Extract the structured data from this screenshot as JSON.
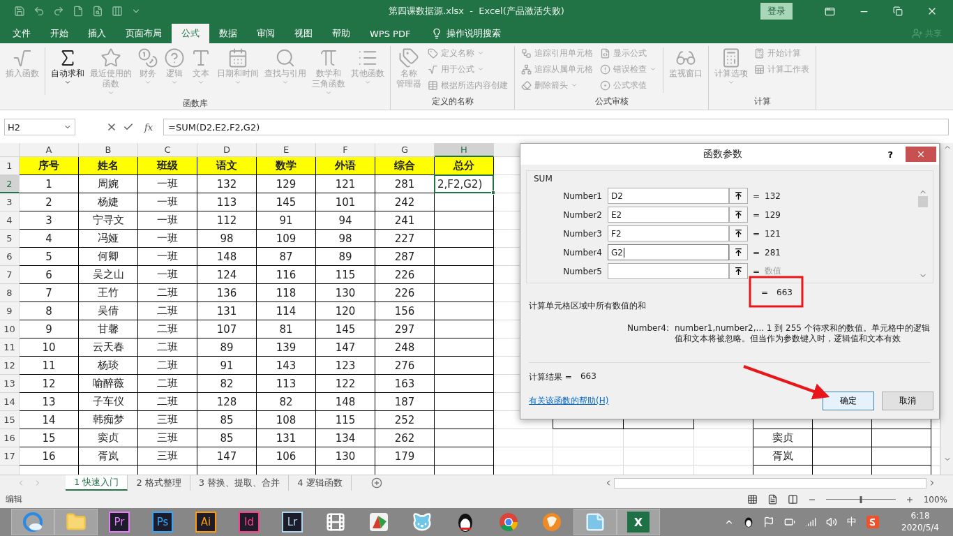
{
  "title_bar": {
    "title": "第四课数据源.xlsx  -  Excel(产品激活失败)",
    "sign_in": "登录"
  },
  "ribbon_tabs": [
    {
      "label": "文件",
      "selected": false
    },
    {
      "label": "开始",
      "selected": false
    },
    {
      "label": "插入",
      "selected": false
    },
    {
      "label": "页面布局",
      "selected": false
    },
    {
      "label": "公式",
      "selected": true
    },
    {
      "label": "数据",
      "selected": false
    },
    {
      "label": "审阅",
      "selected": false
    },
    {
      "label": "视图",
      "selected": false
    },
    {
      "label": "帮助",
      "selected": false
    },
    {
      "label": "WPS PDF",
      "selected": false
    }
  ],
  "tell_me": "操作说明搜索",
  "share": "共享",
  "ribbon_groups": [
    {
      "label": "函数库",
      "items": [
        {
          "label": "插入函数",
          "kind": "large",
          "disabled": true,
          "dropdown": false
        },
        {
          "label": "自动求和",
          "kind": "large",
          "disabled": false,
          "dropdown": true
        },
        {
          "label": "最近使用的",
          "label2": "函数",
          "kind": "large",
          "disabled": true,
          "dropdown": true
        },
        {
          "label": "财务",
          "kind": "large",
          "disabled": true,
          "dropdown": true
        },
        {
          "label": "逻辑",
          "kind": "large",
          "disabled": true,
          "dropdown": true
        },
        {
          "label": "文本",
          "kind": "large",
          "disabled": true,
          "dropdown": true
        },
        {
          "label": "日期和时间",
          "kind": "large",
          "disabled": true,
          "dropdown": true
        },
        {
          "label": "查找与引用",
          "kind": "large",
          "disabled": true,
          "dropdown": true
        },
        {
          "label": "数学和",
          "label2": "三角函数",
          "kind": "large",
          "disabled": true,
          "dropdown": true
        },
        {
          "label": "其他函数",
          "kind": "large",
          "disabled": true,
          "dropdown": true
        }
      ]
    },
    {
      "label": "定义的名称",
      "items": [
        {
          "label": "名称",
          "label2": "管理器",
          "kind": "large",
          "disabled": true,
          "dropdown": false
        },
        {
          "label": "定义名称",
          "kind": "small",
          "disabled": true,
          "dropdown": true
        },
        {
          "label": "用于公式",
          "kind": "small",
          "disabled": true,
          "dropdown": true
        },
        {
          "label": "根据所选内容创建",
          "kind": "small",
          "disabled": true,
          "dropdown": false
        }
      ]
    },
    {
      "label": "公式审核",
      "items": [
        {
          "label": "追踪引用单元格",
          "kind": "small",
          "disabled": true,
          "dropdown": false
        },
        {
          "label": "追踪从属单元格",
          "kind": "small",
          "disabled": true,
          "dropdown": false
        },
        {
          "label": "删除箭头",
          "kind": "small",
          "disabled": true,
          "dropdown": true
        },
        {
          "label": "显示公式",
          "kind": "small",
          "disabled": true,
          "dropdown": false
        },
        {
          "label": "错误检查",
          "kind": "small",
          "disabled": true,
          "dropdown": true
        },
        {
          "label": "公式求值",
          "kind": "small",
          "disabled": true,
          "dropdown": false
        },
        {
          "label": "监视窗口",
          "kind": "large",
          "disabled": true,
          "dropdown": false
        }
      ]
    },
    {
      "label": "计算",
      "items": [
        {
          "label": "计算选项",
          "kind": "large",
          "disabled": true,
          "dropdown": true
        },
        {
          "label": "开始计算",
          "kind": "small",
          "disabled": true,
          "dropdown": false
        },
        {
          "label": "计算工作表",
          "kind": "small",
          "disabled": true,
          "dropdown": false
        }
      ]
    }
  ],
  "formula_bar": {
    "name_box": "H2",
    "insert_function": "fx",
    "formula": "=SUM(D2,E2,F2,G2)"
  },
  "sheet": {
    "columns": [
      {
        "label": "A",
        "selected": false
      },
      {
        "label": "B",
        "selected": false
      },
      {
        "label": "C",
        "selected": false
      },
      {
        "label": "D",
        "selected": false
      },
      {
        "label": "E",
        "selected": false
      },
      {
        "label": "F",
        "selected": false
      },
      {
        "label": "G",
        "selected": false
      },
      {
        "label": "H",
        "selected": true
      }
    ],
    "rows": [
      {
        "number": "1",
        "kind": "header",
        "selected": false,
        "cells": [
          "序号",
          "姓名",
          "班级",
          "语文",
          "数学",
          "外语",
          "综合",
          "总分"
        ]
      },
      {
        "number": "2",
        "kind": "data",
        "selected": true,
        "cells": [
          "1",
          "周婉",
          "一班",
          "132",
          "129",
          "121",
          "281",
          "2,F2,G2)"
        ]
      },
      {
        "number": "3",
        "kind": "data",
        "selected": false,
        "cells": [
          "2",
          "杨婕",
          "一班",
          "113",
          "145",
          "101",
          "242"
        ]
      },
      {
        "number": "4",
        "kind": "data",
        "selected": false,
        "cells": [
          "3",
          "宁寻文",
          "一班",
          "112",
          "91",
          "94",
          "241"
        ]
      },
      {
        "number": "5",
        "kind": "data",
        "selected": false,
        "cells": [
          "4",
          "冯娅",
          "一班",
          "98",
          "109",
          "98",
          "227"
        ]
      },
      {
        "number": "6",
        "kind": "data",
        "selected": false,
        "cells": [
          "5",
          "何卿",
          "一班",
          "148",
          "87",
          "89",
          "287"
        ]
      },
      {
        "number": "7",
        "kind": "data",
        "selected": false,
        "cells": [
          "6",
          "吴之山",
          "一班",
          "124",
          "116",
          "115",
          "226"
        ]
      },
      {
        "number": "8",
        "kind": "data",
        "selected": false,
        "cells": [
          "7",
          "王竹",
          "二班",
          "136",
          "118",
          "130",
          "226"
        ]
      },
      {
        "number": "9",
        "kind": "data",
        "selected": false,
        "cells": [
          "8",
          "吴倩",
          "二班",
          "131",
          "114",
          "120",
          "156"
        ]
      },
      {
        "number": "10",
        "kind": "data",
        "selected": false,
        "cells": [
          "9",
          "甘馨",
          "二班",
          "107",
          "81",
          "145",
          "297"
        ]
      },
      {
        "number": "11",
        "kind": "data",
        "selected": false,
        "cells": [
          "10",
          "云天春",
          "二班",
          "89",
          "139",
          "147",
          "248"
        ]
      },
      {
        "number": "12",
        "kind": "data",
        "selected": false,
        "cells": [
          "11",
          "杨琰",
          "二班",
          "91",
          "143",
          "123",
          "276"
        ]
      },
      {
        "number": "13",
        "kind": "data",
        "selected": false,
        "cells": [
          "12",
          "喻醉薇",
          "二班",
          "82",
          "113",
          "122",
          "163"
        ]
      },
      {
        "number": "14",
        "kind": "data",
        "selected": false,
        "cells": [
          "13",
          "子车仪",
          "二班",
          "128",
          "82",
          "148",
          "187"
        ]
      },
      {
        "number": "15",
        "kind": "data",
        "selected": false,
        "cells": [
          "14",
          "韩痴梦",
          "三班",
          "85",
          "108",
          "115",
          "252"
        ]
      },
      {
        "number": "16",
        "kind": "data",
        "selected": false,
        "cells": [
          "15",
          "窦贞",
          "三班",
          "85",
          "131",
          "134",
          "262"
        ],
        "column_m": "窦贞"
      },
      {
        "number": "17",
        "kind": "data",
        "selected": false,
        "cells": [
          "16",
          "胥岚",
          "三班",
          "147",
          "106",
          "130",
          "179"
        ],
        "column_m": "胥岚"
      }
    ]
  },
  "sheet_tabs": [
    {
      "label": "1 快速入门",
      "selected": true
    },
    {
      "label": "2 格式整理",
      "selected": false
    },
    {
      "label": "3 替换、提取、合并",
      "selected": false
    },
    {
      "label": "4 逻辑函数",
      "selected": false
    }
  ],
  "status_bar": {
    "mode": "编辑",
    "zoom": "100%",
    "level": 0.5
  },
  "dialog": {
    "title": "函数参数",
    "help": "?",
    "function": "SUM",
    "args": [
      {
        "label": "Number1",
        "value": "D2",
        "eq": "=",
        "result": "132",
        "kind": "filled",
        "focused": false
      },
      {
        "label": "Number2",
        "value": "E2",
        "eq": "=",
        "result": "129",
        "kind": "filled",
        "focused": false
      },
      {
        "label": "Number3",
        "value": "F2",
        "eq": "=",
        "result": "121",
        "kind": "filled",
        "focused": false
      },
      {
        "label": "Number4",
        "value": "G2",
        "eq": "=",
        "result": "281",
        "kind": "filled",
        "focused": true
      },
      {
        "label": "Number5",
        "eq": "=",
        "result": "数值",
        "kind": "empty",
        "focused": false
      }
    ],
    "total": {
      "eq": "=",
      "value": "663"
    },
    "description": "计算单元格区域中所有数值的和",
    "arg_help": {
      "label": "Number4:",
      "text": "number1,number2,...  1 到 255 个待求和的数值。单元格中的逻辑值和文本将被忽略。但当作为参数键入时，逻辑值和文本有效"
    },
    "result": {
      "label": "计算结果 =",
      "value": "663"
    },
    "help_link": "有关该函数的帮助(H)",
    "buttons": [
      {
        "label": "确定",
        "default": true
      },
      {
        "label": "取消",
        "default": false
      }
    ]
  },
  "taskbar": {
    "apps": [
      {
        "kind": "browser",
        "active": true
      },
      {
        "kind": "folder",
        "active": true
      },
      {
        "kind": "tile",
        "label": "Pr",
        "color": "#e77bfa",
        "active": false
      },
      {
        "kind": "tile",
        "label": "Ps",
        "color": "#31a8ff",
        "active": false
      },
      {
        "kind": "tile",
        "label": "Ai",
        "color": "#ff9a00",
        "active": false
      },
      {
        "kind": "tile",
        "label": "Id",
        "color": "#ff3e8a",
        "active": false
      },
      {
        "kind": "tile",
        "label": "Lr",
        "color": "#add5ec",
        "active": false
      },
      {
        "kind": "film",
        "active": false
      },
      {
        "kind": "chart",
        "active": false
      },
      {
        "kind": "cat",
        "active": false
      },
      {
        "kind": "penguin",
        "active": false
      },
      {
        "kind": "chrome",
        "active": false
      },
      {
        "kind": "fox",
        "active": false
      },
      {
        "kind": "notepad",
        "active": true
      },
      {
        "kind": "excel",
        "label": "X",
        "active": true
      }
    ],
    "ime": "中",
    "time": "6:18",
    "date": "2020/5/4"
  }
}
